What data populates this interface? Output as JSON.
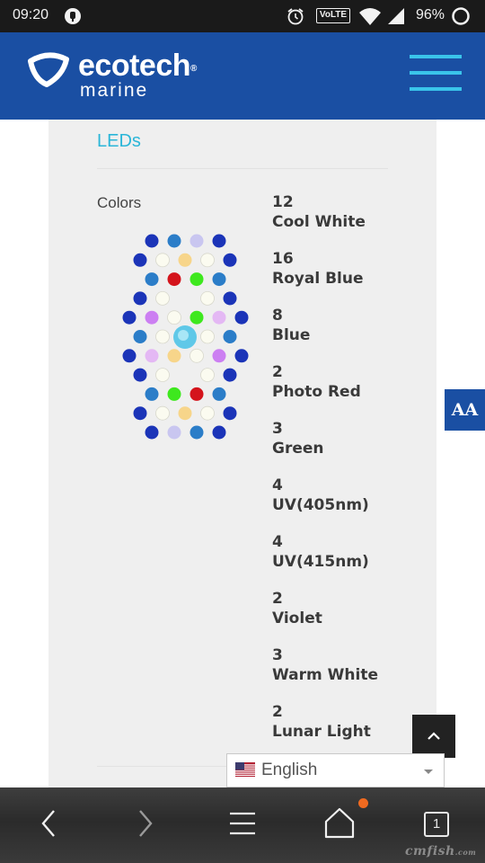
{
  "status_bar": {
    "time": "09:20",
    "volte": "VoLTE",
    "battery": "96%"
  },
  "header": {
    "brand_line1": "ecotech",
    "brand_reg": "®",
    "brand_line2": "marine",
    "colors": {
      "background": "#1a4fa3",
      "accent": "#3ac4ea"
    }
  },
  "section": {
    "title": "LEDs",
    "colors_label": "Colors"
  },
  "led_colors": [
    {
      "count": "12",
      "name": "Cool White"
    },
    {
      "count": "16",
      "name": "Royal Blue"
    },
    {
      "count": "8",
      "name": "Blue"
    },
    {
      "count": "2",
      "name": "Photo Red"
    },
    {
      "count": "3",
      "name": "Green"
    },
    {
      "count": "4",
      "name": "UV(405nm)"
    },
    {
      "count": "4",
      "name": "UV(415nm)"
    },
    {
      "count": "2",
      "name": "Violet"
    },
    {
      "count": "3",
      "name": "Warm White"
    },
    {
      "count": "2",
      "name": "Lunar Light"
    }
  ],
  "accessibility_button": {
    "label": "AA"
  },
  "language_selector": {
    "selected": "English"
  },
  "browser_nav": {
    "tab_count": "1"
  },
  "watermark": {
    "text": "cmfish",
    "suffix": ".com"
  }
}
